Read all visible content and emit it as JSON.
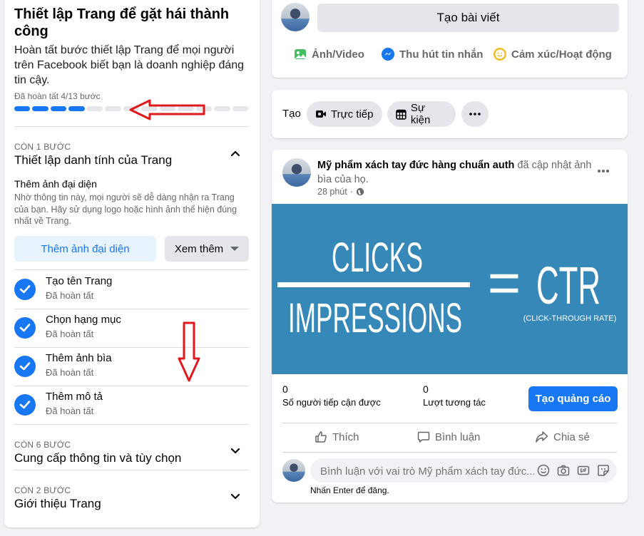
{
  "setup": {
    "title": "Thiết lập Trang để gặt hái thành công",
    "subtitle": "Hoàn tất bước thiết lập Trang để mọi người trên Facebook biết bạn là doanh nghiệp đáng tin cậy.",
    "progress_label": "Đã hoàn tất 4/13 bước",
    "progress": {
      "completed": 4,
      "total": 13
    },
    "section1": {
      "kicker": "CÒN 1 BƯỚC",
      "title": "Thiết lập danh tính của Trang",
      "step_title": "Thêm ảnh đại diện",
      "step_desc": "Nhờ thông tin này, mọi người sẽ dễ dàng nhận ra Trang của bạn. Hãy sử dụng logo hoặc hình ảnh thể hiện đúng nhất về Trang.",
      "primary_button": "Thêm ảnh đại diện",
      "secondary_button": "Xem thêm",
      "done_items": [
        {
          "title": "Tạo tên Trang",
          "status": "Đã hoàn tất"
        },
        {
          "title": "Chọn hạng mục",
          "status": "Đã hoàn tất"
        },
        {
          "title": "Thêm ảnh bìa",
          "status": "Đã hoàn tất"
        },
        {
          "title": "Thêm mô tả",
          "status": "Đã hoàn tất"
        }
      ]
    },
    "section2": {
      "kicker": "CÒN 6 BƯỚC",
      "title": "Cung cấp thông tin và tùy chọn"
    },
    "section3": {
      "kicker": "CÒN 2 BƯỚC",
      "title": "Giới thiệu Trang"
    }
  },
  "composer": {
    "button_label": "Tạo bài viết",
    "actions": [
      "Ảnh/Video",
      "Thu hút tin nhắn",
      "Cảm xúc/Hoạt động"
    ]
  },
  "create_bar": {
    "label": "Tạo",
    "live_label": "Trực tiếp",
    "event_label": "Sự kiện"
  },
  "post": {
    "author": "Mỹ phẩm xách tay đức hàng chuẩn auth",
    "action_text": "đã cập nhật ảnh bìa của họ.",
    "time": "28 phút",
    "banner": {
      "numerator": "CLICKS",
      "denominator": "IMPRESSIONS",
      "equals": "=",
      "result": "CTR",
      "result_caption": "(CLICK-THROUGH RATE)"
    },
    "reach_value": "0",
    "reach_label": "Số người tiếp cận được",
    "engagement_value": "0",
    "engagement_label": "Lượt tương tác",
    "ad_button": "Tạo quảng cáo",
    "like_label": "Thích",
    "comment_label": "Bình luận",
    "share_label": "Chia sẻ",
    "comment_placeholder": "Bình luận với vai trò Mỹ phẩm xách tay đức...",
    "enter_hint": "Nhấn Enter để đăng."
  },
  "colors": {
    "accent": "#1877f2",
    "annotation": "#e0191d",
    "banner": "#3588b8"
  }
}
